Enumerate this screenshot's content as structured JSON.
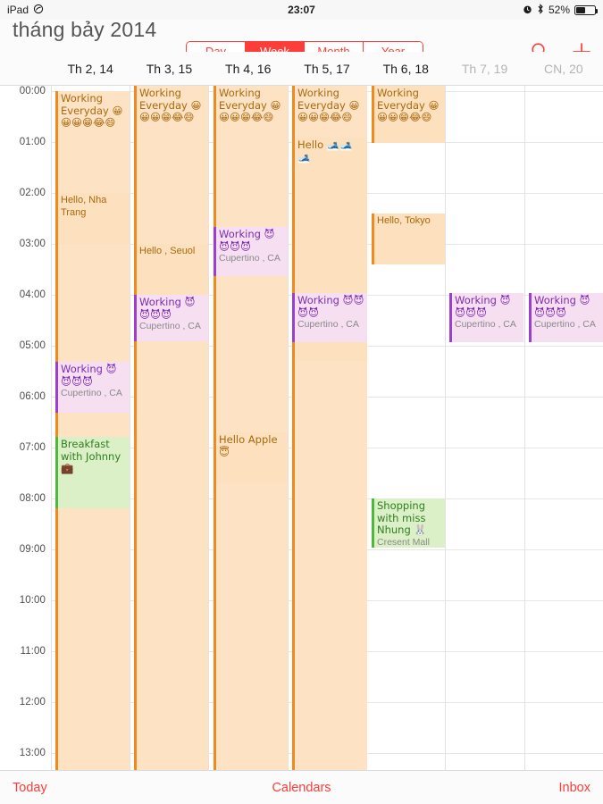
{
  "statusbar": {
    "device": "iPad",
    "wifi_icon": "wifi-icon",
    "time": "23:07",
    "alarm_icon": "alarm-clock-icon",
    "bluetooth_icon": "bluetooth-icon",
    "battery_percent": "52%",
    "battery_icon": "battery-icon"
  },
  "navbar": {
    "title": "tháng bảy 2014",
    "segments": [
      {
        "label": "Day",
        "active": false
      },
      {
        "label": "Week",
        "active": true
      },
      {
        "label": "Month",
        "active": false
      },
      {
        "label": "Year",
        "active": false
      }
    ],
    "search_icon": "search-icon",
    "add_icon": "plus-icon",
    "accent_color": "#fc3d39"
  },
  "day_headers": [
    {
      "label": "Th 2, 14",
      "dim": false
    },
    {
      "label": "Th 3, 15",
      "dim": false
    },
    {
      "label": "Th 4, 16",
      "dim": false
    },
    {
      "label": "Th 5, 17",
      "dim": false
    },
    {
      "label": "Th 6, 18",
      "dim": false
    },
    {
      "label": "Th 7, 19",
      "dim": true
    },
    {
      "label": "CN, 20",
      "dim": true
    }
  ],
  "time_labels": [
    "00:00",
    "01:00",
    "02:00",
    "03:00",
    "04:00",
    "05:00",
    "06:00",
    "07:00",
    "08:00",
    "09:00",
    "10:00",
    "11:00",
    "12:00",
    "13:00"
  ],
  "events": {
    "d0_working_everyday": {
      "title": "Working Everyday 😀😀😀😁😂😄",
      "color": "orange"
    },
    "d0_hello_nha_trang": {
      "title": "Hello, Nha Trang",
      "color": "orange"
    },
    "d0_working_cupertino": {
      "title": "Working 😈😈😈😈",
      "location": "Cupertino , CA",
      "color": "purple"
    },
    "d0_breakfast": {
      "title": "Breakfast with Johnny 💼",
      "color": "green"
    },
    "d1_working_everyday": {
      "title": "Working Everyday 😀😀😀😁😂😄",
      "color": "orange"
    },
    "d1_hello_seuol": {
      "title": "Hello , Seuol",
      "color": "orange"
    },
    "d1_working_cupertino": {
      "title": "Working 😈😈😈😈",
      "location": "Cupertino , CA",
      "color": "purple"
    },
    "d2_working_everyday": {
      "title": "Working Everyday 😀😀😀😁😂😄",
      "color": "orange"
    },
    "d2_working_cupertino": {
      "title": "Working 😈😈😈😈",
      "location": "Cupertino , CA",
      "color": "purple"
    },
    "d2_hello_apple": {
      "title": "Hello Apple 😇",
      "color": "orange"
    },
    "d3_working_everyday": {
      "title": "Working Everyday 😀😀😀😁😂😄",
      "color": "orange"
    },
    "d3_hello_ski": {
      "title": "Hello 🎿🎿🎿",
      "color": "orange"
    },
    "d3_working_cupertino": {
      "title": "Working 😈😈😈😈",
      "location": "Cupertino , CA",
      "color": "purple"
    },
    "d4_working_everyday": {
      "title": "Working Everyday 😀😀😀😁😂😄",
      "color": "orange"
    },
    "d4_hello_tokyo": {
      "title": "Hello, Tokyo",
      "color": "orange"
    },
    "d4_shopping": {
      "title": "Shopping with miss Nhung 🐰",
      "location": "Cresent Mall",
      "color": "green"
    },
    "d5_working_cupertino": {
      "title": "Working 😈😈😈😈",
      "location": "Cupertino , CA",
      "color": "purple"
    },
    "d6_working_cupertino": {
      "title": "Working 😈😈😈😈",
      "location": "Cupertino , CA",
      "color": "purple"
    }
  },
  "toolbar": {
    "today": "Today",
    "calendars": "Calendars",
    "inbox": "Inbox"
  }
}
